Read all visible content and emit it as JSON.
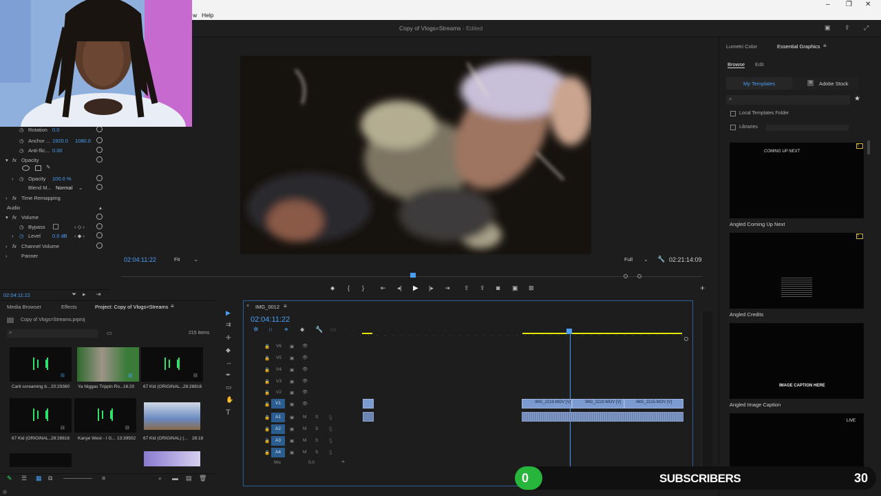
{
  "menu": {
    "partial_item": "w",
    "help": "Help"
  },
  "window": {
    "title": "Copy of Vlogs=Streams",
    "status": "- Edited"
  },
  "effect_controls": {
    "rotation_label": "Rotation",
    "rotation_value": "0.0",
    "anchor_label": "Anchor ...",
    "anchor_x": "1920.0",
    "anchor_y": "1080.0",
    "antiflicker_label": "Anti-flic...",
    "antiflicker_value": "0.00",
    "opacity_section": "Opacity",
    "opacity_label": "Opacity",
    "opacity_value": "100.0 %",
    "blend_label": "Blend M...",
    "blend_value": "Normal",
    "time_remap": "Time Remapping",
    "audio_section": "Audio",
    "volume_section": "Volume",
    "bypass_label": "Bypass",
    "level_label": "Level",
    "level_value": "0.0 dB",
    "channel_volume": "Channel Volume",
    "panner": "Panner",
    "timecode": "02:04:11:22"
  },
  "program_monitor": {
    "timecode": "02:04:11:22",
    "fit": "Fit",
    "quality": "Full",
    "duration": "02:21:14:09"
  },
  "right_panel": {
    "tab_lumetri": "Lumetri Color",
    "tab_essential": "Essential Graphics",
    "sub_browse": "Browse",
    "sub_edit": "Edit",
    "my_templates": "My Templates",
    "adobe_stock": "Adobe Stock",
    "local_folder": "Local Templates Folder",
    "libraries": "Libraries",
    "templates": [
      {
        "name": "Angled Coming Up Next",
        "preview": "COMING UP NEXT"
      },
      {
        "name": "Angled Credits",
        "preview": ""
      },
      {
        "name": "Angled Image Caption",
        "preview": "IMAGE CAPTION HERE"
      },
      {
        "name": "",
        "preview": "LIVE"
      }
    ]
  },
  "project_panel": {
    "tab_media": "Media Browser",
    "tab_effects": "Effects",
    "tab_project": "Project: Copy of Vlogs=Streams",
    "project_file": "Copy of Vlogs=Streams.prproj",
    "item_count": "215 items",
    "assets": [
      {
        "name": "Carti screaming b...",
        "duration": "20:29360"
      },
      {
        "name": "Ya Niggas Trippin Ro...",
        "duration": "16:20"
      },
      {
        "name": "67 Kid (ORIGINAL...",
        "duration": "28:28816"
      },
      {
        "name": "67 Kid (ORIGINAL...",
        "duration": "28:28816"
      },
      {
        "name": "Kanye West - I G...",
        "duration": "13:39502"
      },
      {
        "name": "67 Kid (ORIGINAL) (...",
        "duration": "28:18"
      }
    ]
  },
  "timeline": {
    "sequence": "IMG_0012",
    "timecode": "02:04:11:22",
    "video_tracks": [
      "V6",
      "V5",
      "V4",
      "V3",
      "V2",
      "V1"
    ],
    "audio_tracks": [
      "A1",
      "A2",
      "A3",
      "A4"
    ],
    "mix_label": "Mix",
    "mix_value": "0.0",
    "clips": [
      "IMG_2219.MOV [V]",
      "IMG_2210.MOV [V]",
      "IMG_2215.MOV [V]"
    ]
  },
  "overlay": {
    "sub_count": "0",
    "subscribers": "SUBSCRIBERS",
    "goal": "30"
  }
}
